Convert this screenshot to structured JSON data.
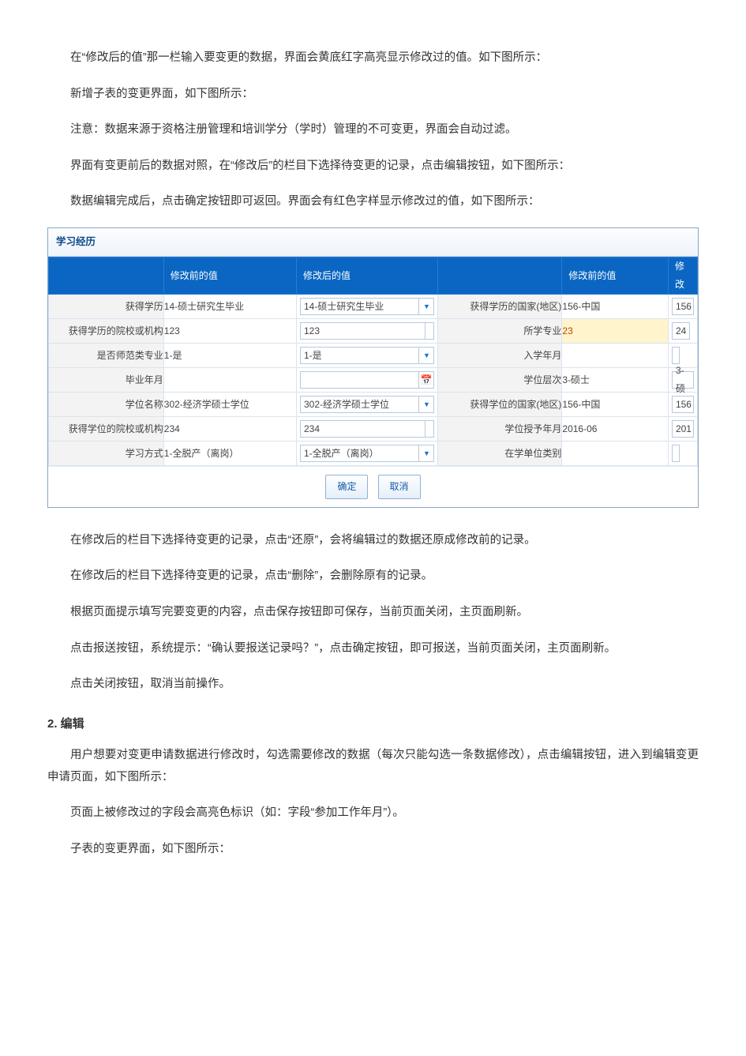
{
  "paragraphs": {
    "p1": "在“修改后的值”那一栏输入要变更的数据，界面会黄底红字高亮显示修改过的值。如下图所示：",
    "p2": "新增子表的变更界面，如下图所示：",
    "p3": "注意：数据来源于资格注册管理和培训学分（学时）管理的不可变更，界面会自动过滤。",
    "p4": "界面有变更前后的数据对照，在“修改后”的栏目下选择待变更的记录，点击编辑按钮，如下图所示：",
    "p5": "数据编辑完成后，点击确定按钮即可返回。界面会有红色字样显示修改过的值，如下图所示：",
    "p6": "在修改后的栏目下选择待变更的记录，点击“还原”，会将编辑过的数据还原成修改前的记录。",
    "p7": "在修改后的栏目下选择待变更的记录，点击“删除”，会删除原有的记录。",
    "p8": "根据页面提示填写完要变更的内容，点击保存按钮即可保存，当前页面关闭，主页面刷新。",
    "p9": "点击报送按钮，系统提示：“确认要报送记录吗？”，点击确定按钮，即可报送，当前页面关闭，主页面刷新。",
    "p10": "点击关闭按钮，取消当前操作。",
    "h2": "2. 编辑",
    "p11": "用户想要对变更申请数据进行修改时，勾选需要修改的数据（每次只能勾选一条数据修改），点击编辑按钮，进入到编辑变更申请页面，如下图所示：",
    "p12": "页面上被修改过的字段会高亮色标识（如：字段“参加工作年月”）。",
    "p13": "子表的变更界面，如下图所示："
  },
  "panel": {
    "title": "学习经历",
    "headers": {
      "blank": "",
      "before": "修改前的值",
      "after": "修改后的值",
      "blank2": "",
      "before2": "修改前的值",
      "after2_cut": "修改"
    },
    "rows": {
      "r1": {
        "label1": "获得学历",
        "before1": "14-硕士研究生毕业",
        "after1": "14-硕士研究生毕业",
        "label2": "获得学历的国家(地区)",
        "before2": "156-中国",
        "after2": "156"
      },
      "r2": {
        "label1": "获得学历的院校或机构",
        "before1": "123",
        "after1": "123",
        "label2": "所学专业",
        "before2": "23",
        "after2": "24"
      },
      "r3": {
        "label1": "是否师范类专业",
        "before1": "1-是",
        "after1": "1-是",
        "label2": "入学年月",
        "before2": "",
        "after2": ""
      },
      "r4": {
        "label1": "毕业年月",
        "before1": "",
        "after1": "",
        "label2": "学位层次",
        "before2": "3-硕士",
        "after2": "3-硕"
      },
      "r5": {
        "label1": "学位名称",
        "before1": "302-经济学硕士学位",
        "after1": "302-经济学硕士学位",
        "label2": "获得学位的国家(地区)",
        "before2": "156-中国",
        "after2": "156"
      },
      "r6": {
        "label1": "获得学位的院校或机构",
        "before1": "234",
        "after1": "234",
        "label2": "学位授予年月",
        "before2": "2016-06",
        "after2": "201"
      },
      "r7": {
        "label1": "学习方式",
        "before1": "1-全脱产（离岗）",
        "after1": "1-全脱产（离岗）",
        "label2": "在学单位类别",
        "before2": "",
        "after2": ""
      }
    },
    "footer": {
      "ok": "确定",
      "cancel": "取消"
    }
  }
}
